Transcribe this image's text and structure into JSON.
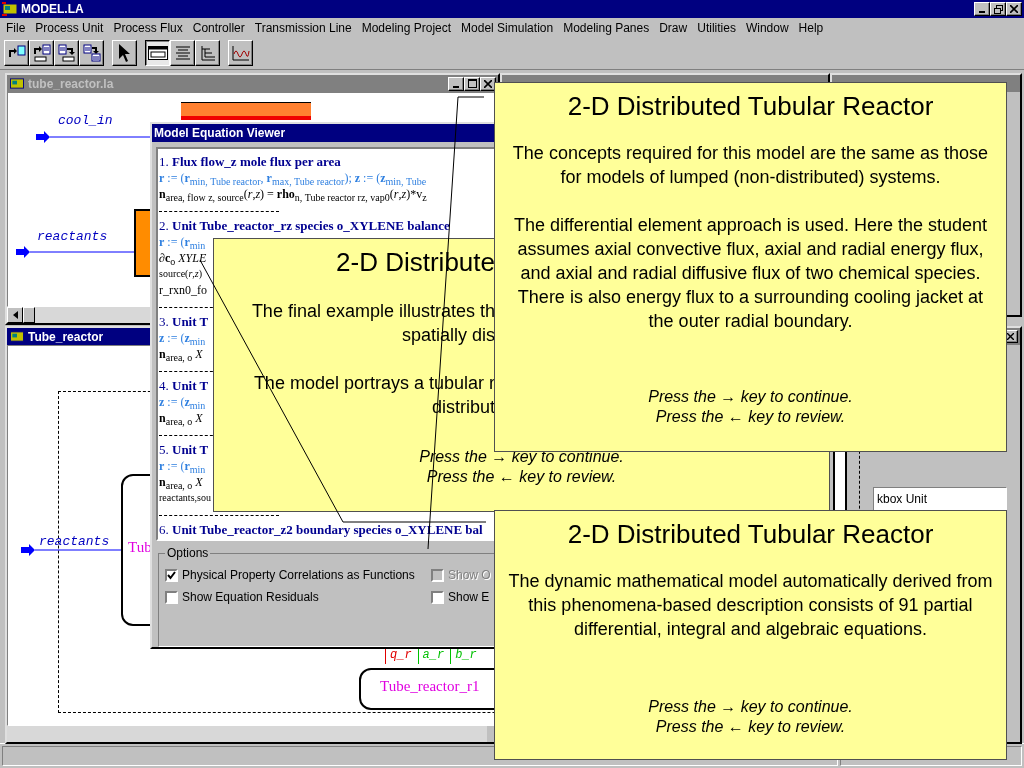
{
  "app": {
    "title": "MODEL.LA"
  },
  "menu": [
    {
      "label": "File"
    },
    {
      "label": "Process Unit"
    },
    {
      "label": "Process Flux"
    },
    {
      "label": "Controller"
    },
    {
      "label": "Transmission Line"
    },
    {
      "label": "Modeling Project"
    },
    {
      "label": "Model Simulation"
    },
    {
      "label": "Modeling Panes"
    },
    {
      "label": "Draw"
    },
    {
      "label": "Utilities"
    },
    {
      "label": "Window"
    },
    {
      "label": "Help"
    }
  ],
  "toolbar": [
    [
      {
        "kind": "doc-out",
        "pressed": false
      },
      {
        "kind": "doc-out-box",
        "pressed": false
      },
      {
        "kind": "doc-in-box",
        "pressed": false
      },
      {
        "kind": "doc-to-doc",
        "pressed": false
      }
    ],
    [
      {
        "kind": "pointer",
        "pressed": false
      }
    ],
    [
      {
        "kind": "panel",
        "pressed": true
      },
      {
        "kind": "lines",
        "pressed": false
      },
      {
        "kind": "tree",
        "pressed": false
      }
    ],
    [
      {
        "kind": "wave",
        "pressed": false
      }
    ]
  ],
  "reactor_window": {
    "title": "tube_reactor.la",
    "active": false,
    "streams": [
      {
        "label": "cool_in"
      },
      {
        "label": "reactants"
      }
    ]
  },
  "diagram_window": {
    "title": "Tube_reactor",
    "active": true,
    "stream": {
      "label": "reactants"
    },
    "unit_label": "Tub",
    "ports": [
      {
        "label": "q_r",
        "color": "#e00000"
      },
      {
        "label": "a_r",
        "color": "#00c000"
      },
      {
        "label": "b_r",
        "color": "#00c000"
      }
    ],
    "sub_unit": "Tube_reactor_r1"
  },
  "side_window": {
    "list": [
      {
        "label": "kbox Unit"
      }
    ]
  },
  "equation_viewer": {
    "title": "Model Equation Viewer",
    "lines": [
      {
        "kind": "heading",
        "text": "1. **Flux flow_z mole flux per area**"
      },
      {
        "kind": "def",
        "text": "**r** := (**r**$_{min, Tube reactor}$, **r**$_{max, Tube reactor}$); **z** := (**z**$_{min, Tube}$"
      },
      {
        "kind": "formula",
        "text": "**n**$_{area, flow z, source}$(*r*,*z*) = **rho**$_{n, Tube reactor rz, vap0}$(*r*,*z*)*v$_{z}$"
      },
      {
        "kind": "rule"
      },
      {
        "kind": "heading",
        "text": "2. **Unit Tube_reactor_rz species o_XYLENE balance**"
      },
      {
        "kind": "def",
        "text": "**r** := (**r**$_{min}$"
      },
      {
        "kind": "formula",
        "text": "∂**c**$_{o}$ *XYLE*"
      },
      {
        "kind": "small",
        "text": "source(*r*,*z*)"
      },
      {
        "kind": "formula",
        "text": "r_rxn0_fo"
      },
      {
        "kind": "rule"
      },
      {
        "kind": "heading",
        "text": "3. **Unit T**"
      },
      {
        "kind": "def",
        "text": "**z** := (**z**$_{min}$"
      },
      {
        "kind": "formula",
        "text": "**n**$_{area, o}$ *X*"
      },
      {
        "kind": "rule"
      },
      {
        "kind": "heading",
        "text": "4. **Unit T**"
      },
      {
        "kind": "def",
        "text": "**z** := (**z**$_{min}$"
      },
      {
        "kind": "formula",
        "text": "**n**$_{area, o}$ *X*"
      },
      {
        "kind": "rule"
      },
      {
        "kind": "heading",
        "text": "5. **Unit T**"
      },
      {
        "kind": "def",
        "text": "**r** := (**r**$_{min}$"
      },
      {
        "kind": "formula",
        "text": "**n**$_{area, o}$ *X*"
      },
      {
        "kind": "small",
        "text": "reactants,sou"
      },
      {
        "kind": "rule"
      },
      {
        "kind": "heading",
        "text": "6. **Unit Tube_reactor_z2 boundary species o_XYLENE bal**"
      }
    ],
    "options": {
      "title": "Options",
      "checks": [
        [
          {
            "label": "Physical Property Correlations as Functions",
            "checked": true,
            "disabled": false
          },
          {
            "label": "Show Equation Residuals",
            "checked": false,
            "disabled": false
          }
        ],
        [
          {
            "label": "Show O",
            "checked": false,
            "disabled": true
          },
          {
            "label": "Show E",
            "checked": false,
            "disabled": false
          }
        ]
      ]
    }
  },
  "slide_back": {
    "title": "2-D Distribute",
    "paragraphs": [
      [
        "The final example illustrates th",
        "spatially dis"
      ],
      [
        "The model portrays a tubular r",
        "distribut"
      ]
    ],
    "hints": [
      "Press the → key to continue.",
      "Press the ← key to review."
    ]
  },
  "slide_top": {
    "title": "2-D Distributed Tubular Reactor",
    "paragraphs": [
      "The concepts required for this model are the same as those for models of lumped (non-distributed) systems.",
      "The differential element approach is used.  Here the student assumes axial convective flux, axial and radial energy flux, and axial and radial diffusive flux of two chemical species.  There is also energy flux to a surrounding cooling jacket at the outer radial boundary."
    ],
    "hints": [
      "Press the → key to continue.",
      "Press the ← key to review."
    ]
  },
  "slide_bottom": {
    "title": "2-D Distributed Tubular Reactor",
    "paragraphs": [
      "The dynamic mathematical model automatically derived from this phenomena-based description consists of 91 partial differential, integral and algebraic equations."
    ],
    "hints": [
      "Press the → key to continue.",
      "Press the ← key to review."
    ]
  }
}
